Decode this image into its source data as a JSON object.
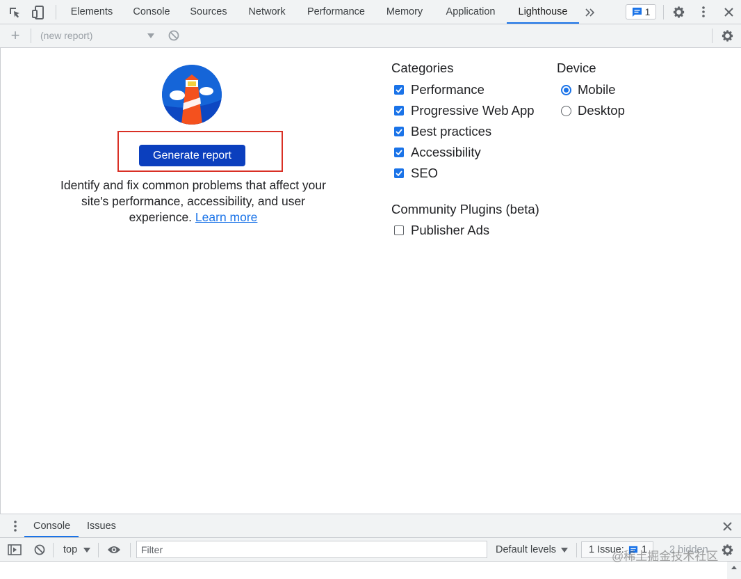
{
  "devtools": {
    "tabs": [
      "Elements",
      "Console",
      "Sources",
      "Network",
      "Performance",
      "Memory",
      "Application",
      "Lighthouse"
    ],
    "active_tab": "Lighthouse",
    "issues_count": "1",
    "icons": [
      "inspect-element-icon",
      "device-toolbar-icon",
      "more-tabs-icon",
      "issues-icon",
      "settings-icon",
      "kebab-menu-icon",
      "close-icon"
    ]
  },
  "lighthouse_toolbar": {
    "add_label": "+",
    "report_select": "(new report)"
  },
  "main": {
    "generate_button": "Generate report",
    "description": "Identify and fix common problems that affect your site's performance, accessibility, and user experience.",
    "learn_more": "Learn more",
    "categories_title": "Categories",
    "categories": [
      {
        "label": "Performance",
        "checked": true
      },
      {
        "label": "Progressive Web App",
        "checked": true
      },
      {
        "label": "Best practices",
        "checked": true
      },
      {
        "label": "Accessibility",
        "checked": true
      },
      {
        "label": "SEO",
        "checked": true
      }
    ],
    "plugins_title": "Community Plugins (beta)",
    "plugins": [
      {
        "label": "Publisher Ads",
        "checked": false
      }
    ],
    "device_title": "Device",
    "devices": [
      {
        "label": "Mobile",
        "selected": true
      },
      {
        "label": "Desktop",
        "selected": false
      }
    ]
  },
  "drawer": {
    "tabs": [
      "Console",
      "Issues"
    ],
    "active_tab": "Console",
    "context": "top",
    "filter_placeholder": "Filter",
    "levels": "Default levels",
    "issues": "1 Issue:",
    "issues_num": "1",
    "hidden": "2 hidden"
  },
  "watermark": "@稀土掘金技术社区",
  "colors": {
    "accent": "#1a73e8",
    "button": "#0b3fbe",
    "highlight": "#d93025"
  }
}
